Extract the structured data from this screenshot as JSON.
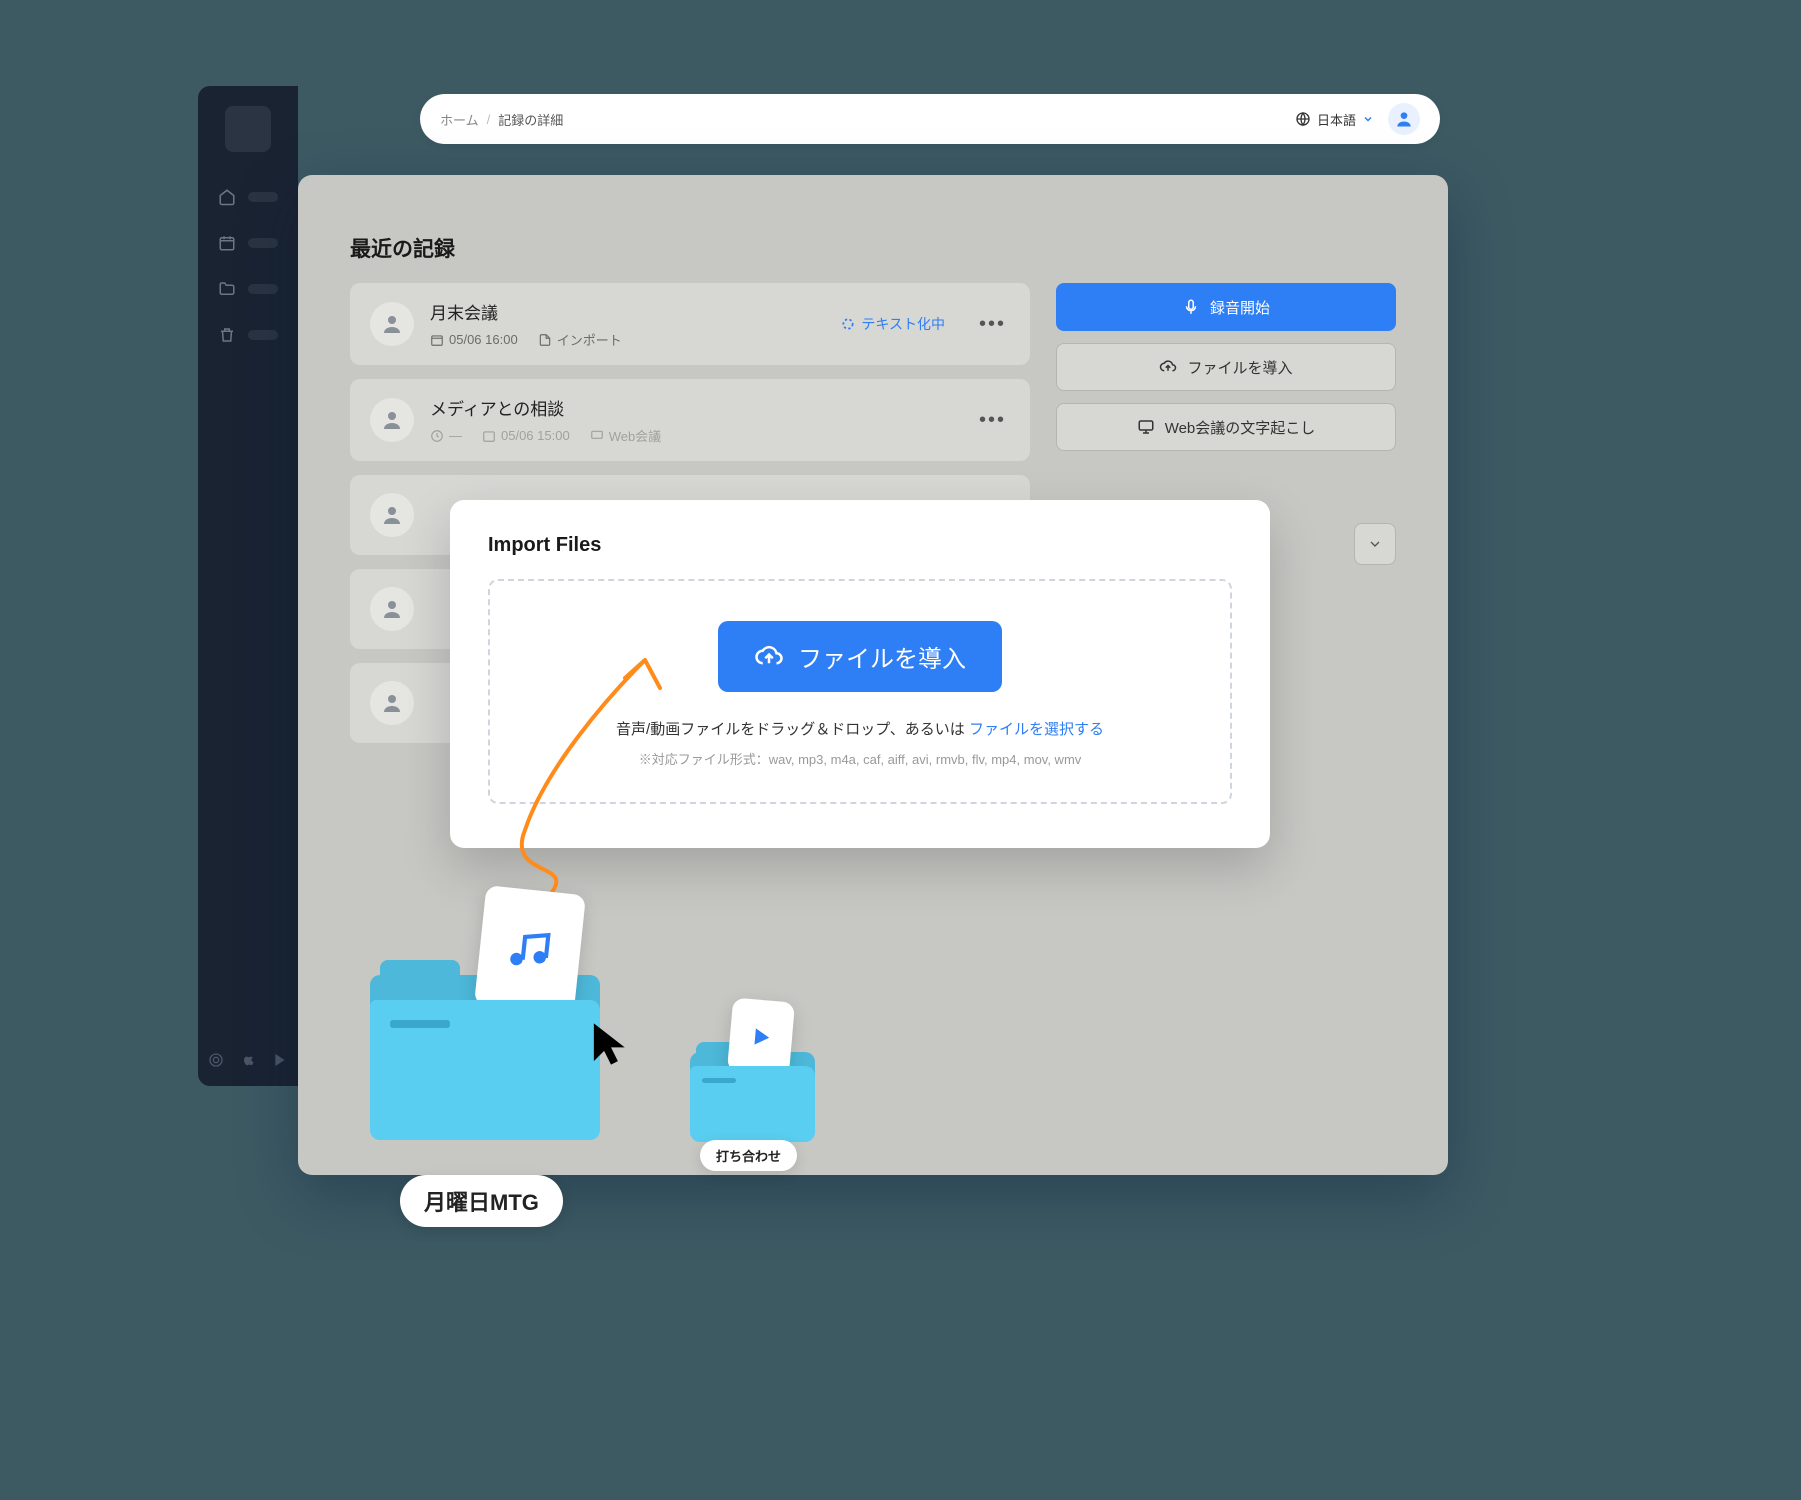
{
  "breadcrumb": {
    "home": "ホーム",
    "sep": "/",
    "current": "記録の詳細"
  },
  "topbar": {
    "language": "日本語"
  },
  "section": {
    "title": "最近の記録"
  },
  "records": [
    {
      "title": "月末会議",
      "date": "05/06 16:00",
      "tag": "インポート",
      "status": "テキスト化中"
    },
    {
      "title": "メディアとの相談",
      "date": "05/06 15:00",
      "tag": "Web会議"
    }
  ],
  "actions": {
    "record": "録音開始",
    "import": "ファイルを導入",
    "transcribe": "Web会議の文字起こし"
  },
  "modal": {
    "title": "Import Files",
    "button": "ファイルを導入",
    "text": "音声/動画ファイルをドラッグ＆ドロップ、あるいは",
    "link": "ファイルを選択する",
    "hint": "※対応ファイル形式：wav, mp3, m4a, caf, aiff, avi, rmvb, flv, mp4, mov, wmv"
  },
  "illus": {
    "label_big": "月曜日MTG",
    "label_sm": "打ち合わせ"
  }
}
